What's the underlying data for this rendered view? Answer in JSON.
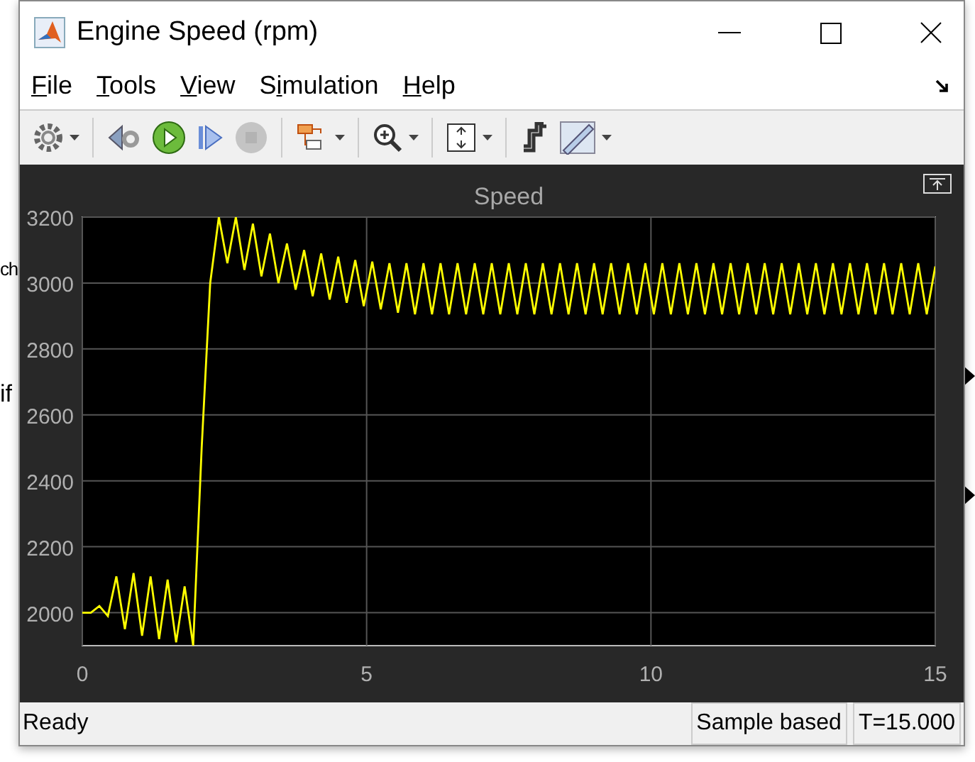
{
  "background": {
    "texts": [
      "ch",
      "if"
    ]
  },
  "window": {
    "title": "Engine Speed (rpm)"
  },
  "menu": [
    {
      "key": "F",
      "after": "ile"
    },
    {
      "key": "T",
      "after": "ools"
    },
    {
      "key": "V",
      "after": "iew"
    },
    {
      "before": "S",
      "key": "i",
      "after": "mulation"
    },
    {
      "key": "H",
      "after": "elp"
    }
  ],
  "toolbar": [
    {
      "kind": "gear",
      "dropdown": true,
      "disabled": false
    },
    {
      "kind": "sep"
    },
    {
      "kind": "step-back",
      "dropdown": false,
      "disabled": false
    },
    {
      "kind": "run",
      "dropdown": false,
      "disabled": false
    },
    {
      "kind": "step-forward",
      "dropdown": false,
      "disabled": false
    },
    {
      "kind": "stop",
      "dropdown": false,
      "disabled": true
    },
    {
      "kind": "sep"
    },
    {
      "kind": "highlight",
      "dropdown": true,
      "disabled": false
    },
    {
      "kind": "sep"
    },
    {
      "kind": "zoom",
      "dropdown": true,
      "disabled": false
    },
    {
      "kind": "sep"
    },
    {
      "kind": "autoscale",
      "dropdown": true,
      "disabled": false
    },
    {
      "kind": "sep"
    },
    {
      "kind": "signal",
      "dropdown": false,
      "disabled": false
    },
    {
      "kind": "ruler",
      "dropdown": true,
      "disabled": false
    }
  ],
  "plot": {
    "chart_data": {
      "type": "line",
      "title": "Speed",
      "grid": true,
      "xlim": [
        0,
        15
      ],
      "ylim": [
        1900,
        3200
      ],
      "xticks": [
        0,
        5,
        10,
        15
      ],
      "yticks": [
        2000,
        2200,
        2400,
        2600,
        2800,
        3000,
        3200
      ],
      "x": [
        0,
        0.15,
        0.3,
        0.45,
        0.6,
        0.75,
        0.9,
        1.05,
        1.2,
        1.35,
        1.5,
        1.65,
        1.8,
        1.95,
        2.1,
        2.25,
        2.4,
        2.55,
        2.7,
        2.85,
        3,
        3.15,
        3.3,
        3.45,
        3.6,
        3.75,
        3.9,
        4.05,
        4.2,
        4.35,
        4.5,
        4.65,
        4.8,
        4.95,
        5.1,
        5.25,
        5.4,
        5.55,
        5.7,
        5.85,
        6,
        6.15,
        6.3,
        6.45,
        6.6,
        6.75,
        6.9,
        7.05,
        7.2,
        7.35,
        7.5,
        7.65,
        7.8,
        7.95,
        8.1,
        8.25,
        8.4,
        8.55,
        8.7,
        8.85,
        9,
        9.15,
        9.3,
        9.45,
        9.6,
        9.75,
        9.9,
        10.05,
        10.2,
        10.35,
        10.5,
        10.65,
        10.8,
        10.95,
        11.1,
        11.25,
        11.4,
        11.55,
        11.7,
        11.85,
        12,
        12.15,
        12.3,
        12.45,
        12.6,
        12.75,
        12.9,
        13.05,
        13.2,
        13.35,
        13.5,
        13.65,
        13.8,
        13.95,
        14.1,
        14.25,
        14.4,
        14.55,
        14.7,
        14.85,
        15
      ],
      "series": [
        {
          "color": "#ffff00",
          "values": [
            2000,
            2000,
            2020,
            1990,
            2110,
            1950,
            2120,
            1930,
            2110,
            1920,
            2100,
            1910,
            2080,
            1900,
            2500,
            3000,
            3200,
            3060,
            3200,
            3040,
            3180,
            3020,
            3150,
            3000,
            3120,
            2980,
            3100,
            2960,
            3090,
            2950,
            3080,
            2940,
            3070,
            2930,
            3065,
            2920,
            3060,
            2910,
            3060,
            2905,
            3060,
            2905,
            3060,
            2905,
            3060,
            2905,
            3060,
            2905,
            3060,
            2905,
            3060,
            2905,
            3060,
            2905,
            3060,
            2905,
            3060,
            2905,
            3060,
            2905,
            3060,
            2905,
            3060,
            2905,
            3060,
            2905,
            3060,
            2905,
            3060,
            2905,
            3060,
            2905,
            3060,
            2905,
            3060,
            2905,
            3060,
            2905,
            3060,
            2905,
            3060,
            2905,
            3060,
            2905,
            3060,
            2905,
            3060,
            2905,
            3060,
            2905,
            3060,
            2905,
            3060,
            2905,
            3060,
            2905,
            3060,
            2905,
            3060,
            2905,
            3050
          ]
        }
      ]
    }
  },
  "status_bar": {
    "status": "Ready",
    "cells": [
      "Sample based",
      "T=15.000"
    ]
  }
}
